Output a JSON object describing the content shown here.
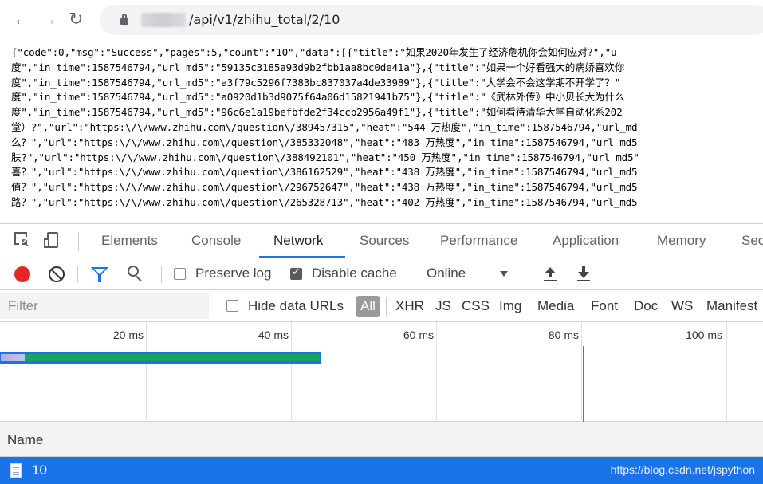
{
  "address_bar": {
    "url": "/api/v1/zhihu_total/2/10"
  },
  "response_lines": [
    "{\"code\":0,\"msg\":\"Success\",\"pages\":5,\"count\":\"10\",\"data\":[{\"title\":\"如果2020年发生了经济危机你会如何应对?\",\"u",
    "度\",\"in_time\":1587546794,\"url_md5\":\"59135c3185a93d9b2fbb1aa8bc0de41a\"},{\"title\":\"如果一个好看强大的病娇喜欢你",
    "度\",\"in_time\":1587546794,\"url_md5\":\"a3f79c5296f7383bc837037a4de33989\"},{\"title\":\"大学会不会这学期不开学了？\"",
    "度\",\"in_time\":1587546794,\"url_md5\":\"a0920d1b3d9075f64a06d15821941b75\"},{\"title\":\"《武林外传》中小贝长大为什么",
    "度\",\"in_time\":1587546794,\"url_md5\":\"96c6e1a19befbfde2f34ccb2956a49f1\"},{\"title\":\"如何看待清华大学自动化系202",
    "堂）?\",\"url\":\"https:\\/\\/www.zhihu.com\\/question\\/389457315\",\"heat\":\"544 万热度\",\"in_time\":1587546794,\"url_md",
    "么？\",\"url\":\"https:\\/\\/www.zhihu.com\\/question\\/385332048\",\"heat\":\"483 万热度\",\"in_time\":1587546794,\"url_md5",
    "肤?\",\"url\":\"https:\\/\\/www.zhihu.com\\/question\\/388492101\",\"heat\":\"450 万热度\",\"in_time\":1587546794,\"url_md5\"",
    "喜？\",\"url\":\"https:\\/\\/www.zhihu.com\\/question\\/386162529\",\"heat\":\"438 万热度\",\"in_time\":1587546794,\"url_md5",
    "值？\",\"url\":\"https:\\/\\/www.zhihu.com\\/question\\/296752647\",\"heat\":\"438 万热度\",\"in_time\":1587546794,\"url_md5",
    "路？\",\"url\":\"https:\\/\\/www.zhihu.com\\/question\\/265328713\",\"heat\":\"402 万热度\",\"in_time\":1587546794,\"url_md5"
  ],
  "devtools": {
    "tabs": [
      "Elements",
      "Console",
      "Network",
      "Sources",
      "Performance",
      "Application",
      "Memory",
      "Sec"
    ],
    "active_tab": "Network",
    "toolbar": {
      "preserve_log": "Preserve log",
      "preserve_log_checked": false,
      "disable_cache": "Disable cache",
      "disable_cache_checked": true,
      "throttling": "Online"
    },
    "filter": {
      "placeholder": "Filter",
      "hide_data_urls": "Hide data URLs",
      "types": [
        "All",
        "XHR",
        "JS",
        "CSS",
        "Img",
        "Media",
        "Font",
        "Doc",
        "WS",
        "Manifest"
      ],
      "active_type": "All"
    },
    "timeline": {
      "ticks": [
        "20 ms",
        "40 ms",
        "60 ms",
        "80 ms",
        "100 ms"
      ]
    },
    "table": {
      "header_name": "Name",
      "rows": [
        {
          "name": "10",
          "selected": true
        }
      ]
    }
  },
  "watermark": "https://blog.csdn.net/jspython",
  "colors": {
    "accent_blue": "#1a73e8",
    "record_red": "#e82525",
    "timing_green": "#1aa35a"
  },
  "icons": [
    "back-arrow-icon",
    "forward-arrow-icon",
    "reload-icon",
    "lock-icon",
    "inspect-element-icon",
    "device-toolbar-icon",
    "record-icon",
    "clear-icon",
    "filter-icon",
    "search-icon",
    "upload-icon",
    "download-icon",
    "document-icon"
  ]
}
